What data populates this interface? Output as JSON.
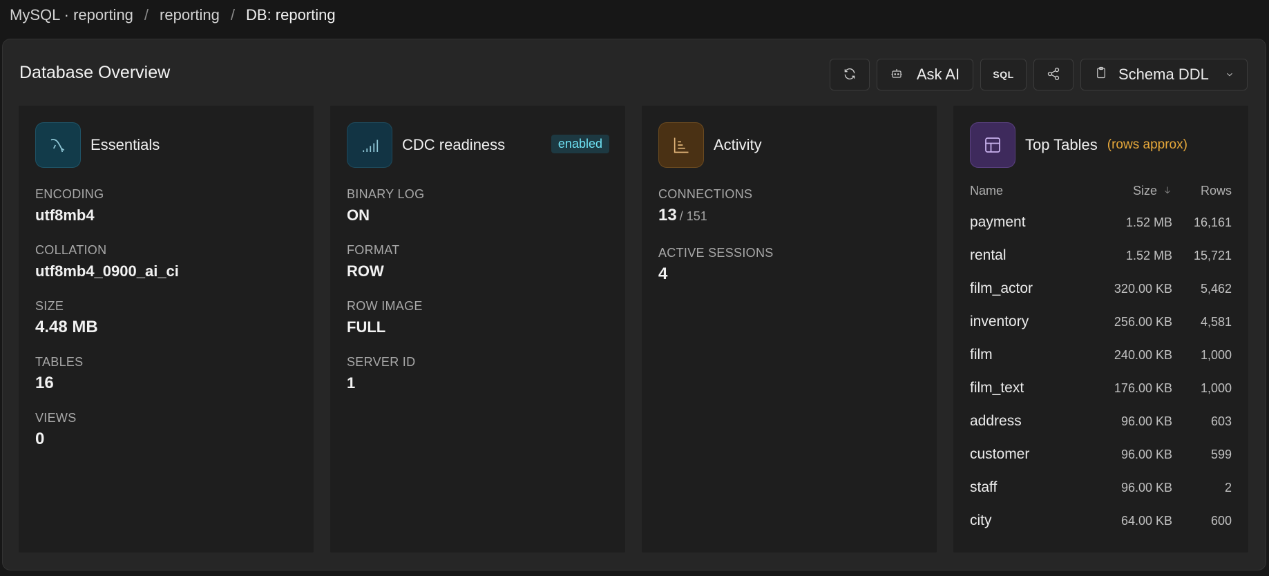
{
  "breadcrumb": {
    "items": [
      "MySQL · reporting",
      "reporting",
      "DB: reporting"
    ],
    "separator": "/"
  },
  "page": {
    "title": "Database Overview"
  },
  "toolbar": {
    "ask_ai_label": "Ask AI",
    "sql_label": "SQL",
    "schema_ddl_label": "Schema DDL",
    "icons": [
      "refresh-icon",
      "bot-icon",
      "share-icon",
      "clipboard-icon",
      "chevron-down-icon"
    ]
  },
  "essentials": {
    "title": "Essentials",
    "icon": "mysql-dolphin-icon",
    "encoding_label": "ENCODING",
    "encoding": "utf8mb4",
    "collation_label": "COLLATION",
    "collation": "utf8mb4_0900_ai_ci",
    "size_label": "SIZE",
    "size": "4.48 MB",
    "tables_label": "TABLES",
    "tables": "16",
    "views_label": "VIEWS",
    "views": "0"
  },
  "cdc": {
    "title": "CDC readiness",
    "icon": "signal-bars-icon",
    "badge": "enabled",
    "binary_log_label": "BINARY LOG",
    "binary_log": "ON",
    "format_label": "FORMAT",
    "format": "ROW",
    "row_image_label": "ROW IMAGE",
    "row_image": "FULL",
    "server_id_label": "SERVER ID",
    "server_id": "1"
  },
  "activity": {
    "title": "Activity",
    "icon": "chart-icon",
    "connections_label": "CONNECTIONS",
    "connections": "13",
    "connections_max": "/ 151",
    "active_sessions_label": "ACTIVE SESSIONS",
    "active_sessions": "4"
  },
  "top_tables": {
    "title": "Top Tables",
    "subtitle": "(rows approx)",
    "icon": "table-icon",
    "columns": {
      "name": "Name",
      "size": "Size",
      "rows": "Rows"
    },
    "rows": [
      {
        "name": "payment",
        "size": "1.52 MB",
        "rows": "16,161"
      },
      {
        "name": "rental",
        "size": "1.52 MB",
        "rows": "15,721"
      },
      {
        "name": "film_actor",
        "size": "320.00 KB",
        "rows": "5,462"
      },
      {
        "name": "inventory",
        "size": "256.00 KB",
        "rows": "4,581"
      },
      {
        "name": "film",
        "size": "240.00 KB",
        "rows": "1,000"
      },
      {
        "name": "film_text",
        "size": "176.00 KB",
        "rows": "1,000"
      },
      {
        "name": "address",
        "size": "96.00 KB",
        "rows": "603"
      },
      {
        "name": "customer",
        "size": "96.00 KB",
        "rows": "599"
      },
      {
        "name": "staff",
        "size": "96.00 KB",
        "rows": "2"
      },
      {
        "name": "city",
        "size": "64.00 KB",
        "rows": "600"
      }
    ]
  },
  "colors": {
    "essentials_icon_bg": "#123b4a",
    "cdc_icon_bg": "#123444",
    "activity_icon_bg": "#4a3114",
    "tables_icon_bg": "#3e2a5c",
    "badge_text": "#6fe3f5",
    "subtitle": "#e8a93a"
  }
}
